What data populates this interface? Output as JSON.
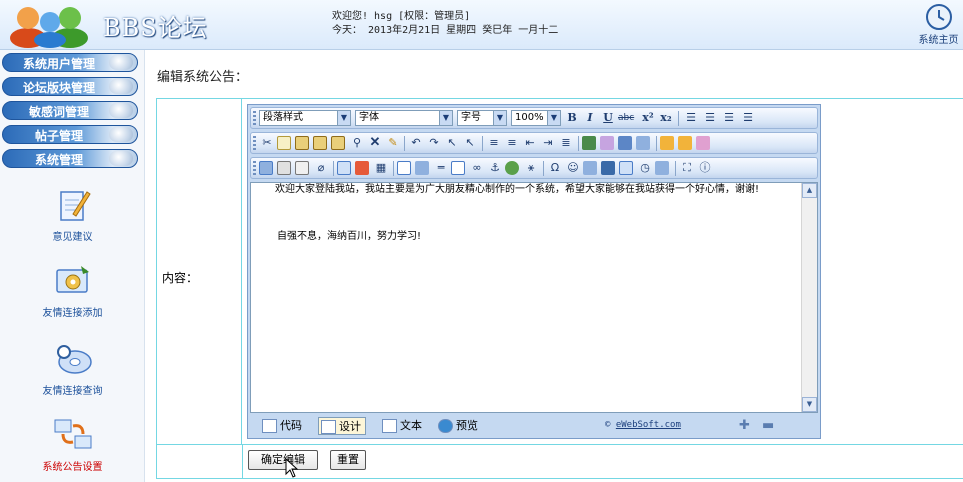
{
  "header": {
    "logo_text": "BBS论坛",
    "welcome_line1": "欢迎您! hsg [权限：管理员]",
    "welcome_line2": "今天： 2013年2月21日 星期四 癸巳年 一月十二",
    "home_label": "系统主页"
  },
  "sidebar": {
    "menu": [
      {
        "label": "系统用户管理"
      },
      {
        "label": "论坛版块管理"
      },
      {
        "label": "敏感词管理"
      },
      {
        "label": "帖子管理"
      },
      {
        "label": "系统管理"
      }
    ],
    "icons": [
      {
        "label": "意见建议",
        "icon": "notepad-pen-icon"
      },
      {
        "label": "友情连接添加",
        "icon": "monitor-gear-icon"
      },
      {
        "label": "友情连接查询",
        "icon": "disc-search-icon"
      },
      {
        "label": "系统公告设置",
        "icon": "computers-network-icon"
      }
    ]
  },
  "main": {
    "title": "编辑系统公告：",
    "content_label": "内容："
  },
  "editor": {
    "paragraph_style": "段落样式",
    "font": "字体",
    "font_size": "字号",
    "zoom": "100%",
    "content_p1": "欢迎大家登陆我站，我站主要是为广大朋友精心制作的一个系统，希望大家能够在我站获得一个好心情，谢谢!",
    "content_p2": "自强不息，海纳百川，努力学习!",
    "modes": {
      "code": "代码",
      "design": "设计",
      "text": "文本",
      "preview": "预览"
    },
    "brand_prefix": "© ",
    "brand_link": "eWebSoft.com"
  },
  "buttons": {
    "confirm": "确定编辑",
    "reset": "重置"
  },
  "colors": {
    "border_accent": "#74d7e3",
    "menu_blue": "#2c6bb8",
    "editor_bg": "#c5d9f1"
  }
}
